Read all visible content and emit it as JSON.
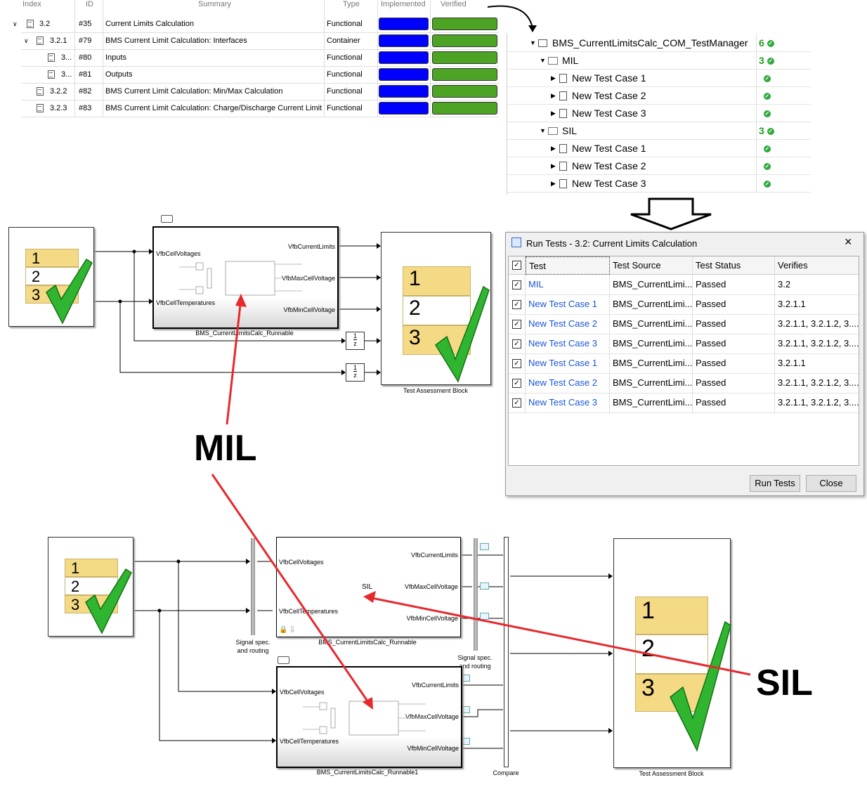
{
  "req_table": {
    "headers": [
      "Index",
      "ID",
      "Summary",
      "Type",
      "Implemented",
      "Verified"
    ],
    "rows": [
      {
        "index": "3.2",
        "id": "#35",
        "summary": "Current Limits Calculation",
        "type": "Functional"
      },
      {
        "index": "3.2.1",
        "id": "#79",
        "summary": "BMS Current Limit Calculation: Interfaces",
        "type": "Container"
      },
      {
        "index": "3...",
        "id": "#80",
        "summary": "Inputs",
        "type": "Functional"
      },
      {
        "index": "3...",
        "id": "#81",
        "summary": "Outputs",
        "type": "Functional"
      },
      {
        "index": "3.2.2",
        "id": "#82",
        "summary": "BMS Current Limit Calculation: Min/Max Calculation",
        "type": "Functional"
      },
      {
        "index": "3.2.3",
        "id": "#83",
        "summary": "BMS Current Limit Calculation: Charge/Discharge Current Limit",
        "type": "Functional"
      }
    ],
    "implemented_color": "#0000ff",
    "verified_color": "#4ca324"
  },
  "test_manager": {
    "rows": [
      {
        "label": "BMS_CurrentLimitsCalc_COM_TestManager",
        "count": "6"
      },
      {
        "label": "MIL",
        "count": "3"
      },
      {
        "label": "New Test Case 1",
        "count": ""
      },
      {
        "label": "New Test Case 2",
        "count": ""
      },
      {
        "label": "New Test Case 3",
        "count": ""
      },
      {
        "label": "SIL",
        "count": "3"
      },
      {
        "label": "New Test Case 1",
        "count": ""
      },
      {
        "label": "New Test Case 2",
        "count": ""
      },
      {
        "label": "New Test Case 3",
        "count": ""
      }
    ]
  },
  "dialog": {
    "title": "Run Tests - 3.2: Current Limits Calculation",
    "columns": [
      "Test",
      "Test Source",
      "Test Status",
      "Verifies"
    ],
    "rows": [
      {
        "test": "MIL",
        "source": "BMS_CurrentLimi...",
        "status": "Passed",
        "verifies": "3.2"
      },
      {
        "test": "New Test Case 1",
        "source": "BMS_CurrentLimi...",
        "status": "Passed",
        "verifies": "3.2.1.1"
      },
      {
        "test": "New Test Case 2",
        "source": "BMS_CurrentLimi...",
        "status": "Passed",
        "verifies": "3.2.1.1, 3.2.1.2, 3...."
      },
      {
        "test": "New Test Case 3",
        "source": "BMS_CurrentLimi...",
        "status": "Passed",
        "verifies": "3.2.1.1, 3.2.1.2, 3...."
      },
      {
        "test": "New Test Case 1",
        "source": "BMS_CurrentLimi...",
        "status": "Passed",
        "verifies": "3.2.1.1"
      },
      {
        "test": "New Test Case 2",
        "source": "BMS_CurrentLimi...",
        "status": "Passed",
        "verifies": "3.2.1.1, 3.2.1.2, 3...."
      },
      {
        "test": "New Test Case 3",
        "source": "BMS_CurrentLimi...",
        "status": "Passed",
        "verifies": "3.2.1.1, 3.2.1.2, 3...."
      }
    ],
    "run_label": "Run Tests",
    "close_label": "Close"
  },
  "mil_model": {
    "subsystem_name": "BMS_CurrentLimitsCalc_Runnable",
    "in_ports": [
      "VfbCellVoltages",
      "VfbCellTemperatures"
    ],
    "out_ports": [
      "VfbCurrentLimits",
      "VfbMaxCellVoltage",
      "VfbMinCellVoltage"
    ],
    "delay_num": "1",
    "delay_den": "z",
    "assessment_label": "Test Assessment Block"
  },
  "sil_model": {
    "sil_subsystem_name": "BMS_CurrentLimitsCalc_Runnable",
    "sil_text": "SIL",
    "mil_subsystem_name": "BMS_CurrentLimitsCalc_Runnable1",
    "in_ports": [
      "VfbCellVoltages",
      "VfbCellTemperatures"
    ],
    "out_ports": [
      "VfbCurrentLimits",
      "VfbMaxCellVoltage",
      "VfbMinCellVoltage"
    ],
    "signal_spec_label": "Signal spec.\nand routing",
    "compare_label": "Compare",
    "assessment_label": "Test Assessment Block"
  },
  "sequence_digits": [
    "1",
    "2",
    "3"
  ],
  "annotations": {
    "mil": "MIL",
    "sil": "SIL"
  }
}
